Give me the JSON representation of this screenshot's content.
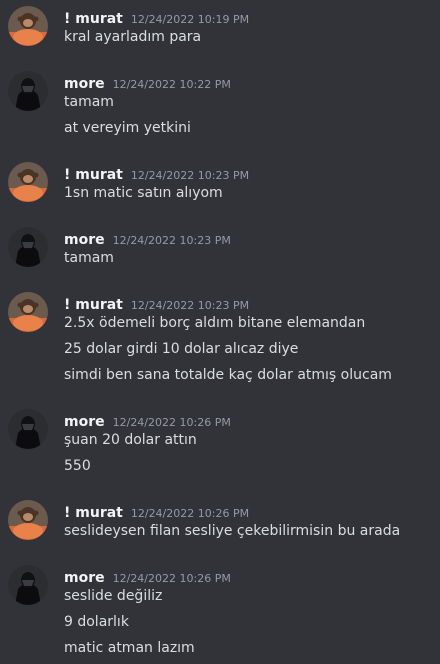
{
  "messages": [
    {
      "author": "! murat",
      "avatar": "monkey-avatar-icon",
      "timestamp": "12/24/2022 10:19 PM",
      "lines": [
        "kral ayarladım para"
      ]
    },
    {
      "author": "more",
      "avatar": "darth-vader-avatar-icon",
      "timestamp": "12/24/2022 10:22 PM",
      "lines": [
        "tamam",
        "at vereyim yetkini"
      ]
    },
    {
      "author": "! murat",
      "avatar": "monkey-avatar-icon",
      "timestamp": "12/24/2022 10:23 PM",
      "lines": [
        "1sn matic satın alıyom"
      ]
    },
    {
      "author": "more",
      "avatar": "darth-vader-avatar-icon",
      "timestamp": "12/24/2022 10:23 PM",
      "lines": [
        "tamam"
      ]
    },
    {
      "author": "! murat",
      "avatar": "monkey-avatar-icon",
      "timestamp": "12/24/2022 10:23 PM",
      "lines": [
        "2.5x ödemeli borç aldım bitane elemandan",
        "25 dolar girdi 10 dolar alıcaz diye",
        "simdi ben sana totalde kaç dolar atmış olucam"
      ]
    },
    {
      "author": "more",
      "avatar": "darth-vader-avatar-icon",
      "timestamp": "12/24/2022 10:26 PM",
      "lines": [
        "şuan 20 dolar attın",
        "550"
      ]
    },
    {
      "author": "! murat",
      "avatar": "monkey-avatar-icon",
      "timestamp": "12/24/2022 10:26 PM",
      "lines": [
        "seslideysen filan sesliye çekebilirmisin bu arada"
      ]
    },
    {
      "author": "more",
      "avatar": "darth-vader-avatar-icon",
      "timestamp": "12/24/2022 10:26 PM",
      "lines": [
        "seslide değiliz",
        "9 dolarlık",
        "matic atman lazım"
      ]
    }
  ]
}
